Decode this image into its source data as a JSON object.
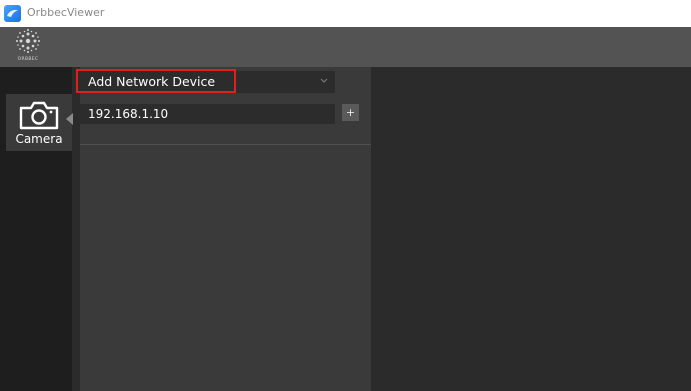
{
  "window": {
    "title": "OrbbecViewer",
    "app_icon": "orbbec-app-icon"
  },
  "header": {
    "logo_text": "ORBBEC",
    "logo_icon": "orbbec-logo-icon"
  },
  "sidebar": {
    "items": [
      {
        "label": "Camera",
        "icon": "camera-icon",
        "selected": true
      }
    ]
  },
  "panel": {
    "mode_dropdown": {
      "value": "Add Network Device",
      "highlighted": true,
      "highlight_color": "#e0201c"
    },
    "ip_input": {
      "value": "192.168.1.10"
    },
    "add_button_label": "+"
  },
  "colors": {
    "rail_bg": "#1e1e1e",
    "panel_bg": "#3a3a3a",
    "main_bg": "#2b2b2b",
    "header_bg": "#535353"
  }
}
